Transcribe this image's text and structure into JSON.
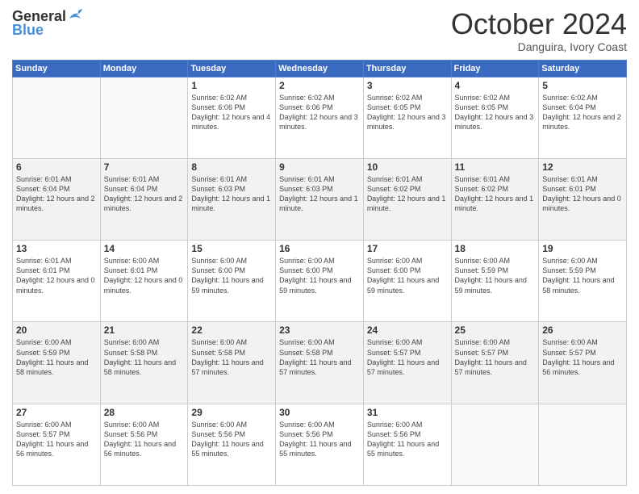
{
  "header": {
    "logo_general": "General",
    "logo_blue": "Blue",
    "month": "October 2024",
    "location": "Danguira, Ivory Coast"
  },
  "weekdays": [
    "Sunday",
    "Monday",
    "Tuesday",
    "Wednesday",
    "Thursday",
    "Friday",
    "Saturday"
  ],
  "weeks": [
    [
      {
        "day": "",
        "info": ""
      },
      {
        "day": "",
        "info": ""
      },
      {
        "day": "1",
        "info": "Sunrise: 6:02 AM\nSunset: 6:06 PM\nDaylight: 12 hours and 4 minutes."
      },
      {
        "day": "2",
        "info": "Sunrise: 6:02 AM\nSunset: 6:06 PM\nDaylight: 12 hours and 3 minutes."
      },
      {
        "day": "3",
        "info": "Sunrise: 6:02 AM\nSunset: 6:05 PM\nDaylight: 12 hours and 3 minutes."
      },
      {
        "day": "4",
        "info": "Sunrise: 6:02 AM\nSunset: 6:05 PM\nDaylight: 12 hours and 3 minutes."
      },
      {
        "day": "5",
        "info": "Sunrise: 6:02 AM\nSunset: 6:04 PM\nDaylight: 12 hours and 2 minutes."
      }
    ],
    [
      {
        "day": "6",
        "info": "Sunrise: 6:01 AM\nSunset: 6:04 PM\nDaylight: 12 hours and 2 minutes."
      },
      {
        "day": "7",
        "info": "Sunrise: 6:01 AM\nSunset: 6:04 PM\nDaylight: 12 hours and 2 minutes."
      },
      {
        "day": "8",
        "info": "Sunrise: 6:01 AM\nSunset: 6:03 PM\nDaylight: 12 hours and 1 minute."
      },
      {
        "day": "9",
        "info": "Sunrise: 6:01 AM\nSunset: 6:03 PM\nDaylight: 12 hours and 1 minute."
      },
      {
        "day": "10",
        "info": "Sunrise: 6:01 AM\nSunset: 6:02 PM\nDaylight: 12 hours and 1 minute."
      },
      {
        "day": "11",
        "info": "Sunrise: 6:01 AM\nSunset: 6:02 PM\nDaylight: 12 hours and 1 minute."
      },
      {
        "day": "12",
        "info": "Sunrise: 6:01 AM\nSunset: 6:01 PM\nDaylight: 12 hours and 0 minutes."
      }
    ],
    [
      {
        "day": "13",
        "info": "Sunrise: 6:01 AM\nSunset: 6:01 PM\nDaylight: 12 hours and 0 minutes."
      },
      {
        "day": "14",
        "info": "Sunrise: 6:00 AM\nSunset: 6:01 PM\nDaylight: 12 hours and 0 minutes."
      },
      {
        "day": "15",
        "info": "Sunrise: 6:00 AM\nSunset: 6:00 PM\nDaylight: 11 hours and 59 minutes."
      },
      {
        "day": "16",
        "info": "Sunrise: 6:00 AM\nSunset: 6:00 PM\nDaylight: 11 hours and 59 minutes."
      },
      {
        "day": "17",
        "info": "Sunrise: 6:00 AM\nSunset: 6:00 PM\nDaylight: 11 hours and 59 minutes."
      },
      {
        "day": "18",
        "info": "Sunrise: 6:00 AM\nSunset: 5:59 PM\nDaylight: 11 hours and 59 minutes."
      },
      {
        "day": "19",
        "info": "Sunrise: 6:00 AM\nSunset: 5:59 PM\nDaylight: 11 hours and 58 minutes."
      }
    ],
    [
      {
        "day": "20",
        "info": "Sunrise: 6:00 AM\nSunset: 5:59 PM\nDaylight: 11 hours and 58 minutes."
      },
      {
        "day": "21",
        "info": "Sunrise: 6:00 AM\nSunset: 5:58 PM\nDaylight: 11 hours and 58 minutes."
      },
      {
        "day": "22",
        "info": "Sunrise: 6:00 AM\nSunset: 5:58 PM\nDaylight: 11 hours and 57 minutes."
      },
      {
        "day": "23",
        "info": "Sunrise: 6:00 AM\nSunset: 5:58 PM\nDaylight: 11 hours and 57 minutes."
      },
      {
        "day": "24",
        "info": "Sunrise: 6:00 AM\nSunset: 5:57 PM\nDaylight: 11 hours and 57 minutes."
      },
      {
        "day": "25",
        "info": "Sunrise: 6:00 AM\nSunset: 5:57 PM\nDaylight: 11 hours and 57 minutes."
      },
      {
        "day": "26",
        "info": "Sunrise: 6:00 AM\nSunset: 5:57 PM\nDaylight: 11 hours and 56 minutes."
      }
    ],
    [
      {
        "day": "27",
        "info": "Sunrise: 6:00 AM\nSunset: 5:57 PM\nDaylight: 11 hours and 56 minutes."
      },
      {
        "day": "28",
        "info": "Sunrise: 6:00 AM\nSunset: 5:56 PM\nDaylight: 11 hours and 56 minutes."
      },
      {
        "day": "29",
        "info": "Sunrise: 6:00 AM\nSunset: 5:56 PM\nDaylight: 11 hours and 55 minutes."
      },
      {
        "day": "30",
        "info": "Sunrise: 6:00 AM\nSunset: 5:56 PM\nDaylight: 11 hours and 55 minutes."
      },
      {
        "day": "31",
        "info": "Sunrise: 6:00 AM\nSunset: 5:56 PM\nDaylight: 11 hours and 55 minutes."
      },
      {
        "day": "",
        "info": ""
      },
      {
        "day": "",
        "info": ""
      }
    ]
  ]
}
